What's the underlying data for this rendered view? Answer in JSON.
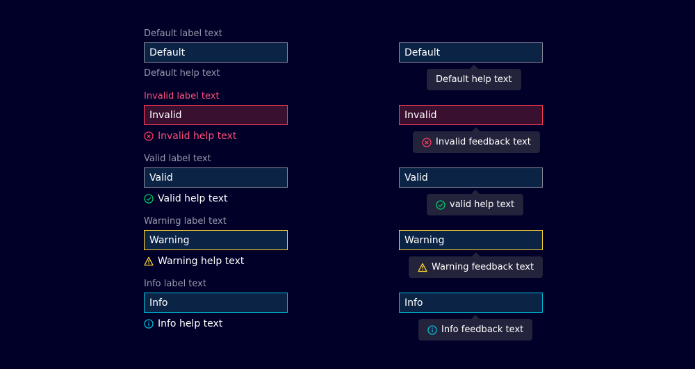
{
  "colors": {
    "background": "#000028",
    "invalid": "#ff3b5c",
    "valid": "#00cc66",
    "warning": "#ffd732",
    "info": "#00bedc",
    "tooltip": "#23233c"
  },
  "left": {
    "default": {
      "label": "Default label text",
      "value": "Default",
      "help": "Default help text"
    },
    "invalid": {
      "label": "Invalid label text",
      "value": "Invalid",
      "help": "Invalid help text",
      "icon": "error-circle-icon"
    },
    "valid": {
      "label": "Valid label text",
      "value": "Valid",
      "help": "Valid help text",
      "icon": "check-circle-icon"
    },
    "warning": {
      "label": "Warning label text",
      "value": "Warning",
      "help": "Warning help text",
      "icon": "warning-triangle-icon"
    },
    "info": {
      "label": "Info label text",
      "value": "Info",
      "help": "Info help text",
      "icon": "info-circle-icon"
    }
  },
  "right": {
    "default": {
      "value": "Default",
      "tooltip": "Default help text"
    },
    "invalid": {
      "value": "Invalid",
      "tooltip": "Invalid feedback text",
      "icon": "error-circle-icon"
    },
    "valid": {
      "value": "Valid",
      "tooltip": "valid help text",
      "icon": "check-circle-icon"
    },
    "warning": {
      "value": "Warning",
      "tooltip": "Warning feedback text",
      "icon": "warning-triangle-icon"
    },
    "info": {
      "value": "Info",
      "tooltip": "Info feedback text",
      "icon": "info-circle-icon"
    }
  }
}
